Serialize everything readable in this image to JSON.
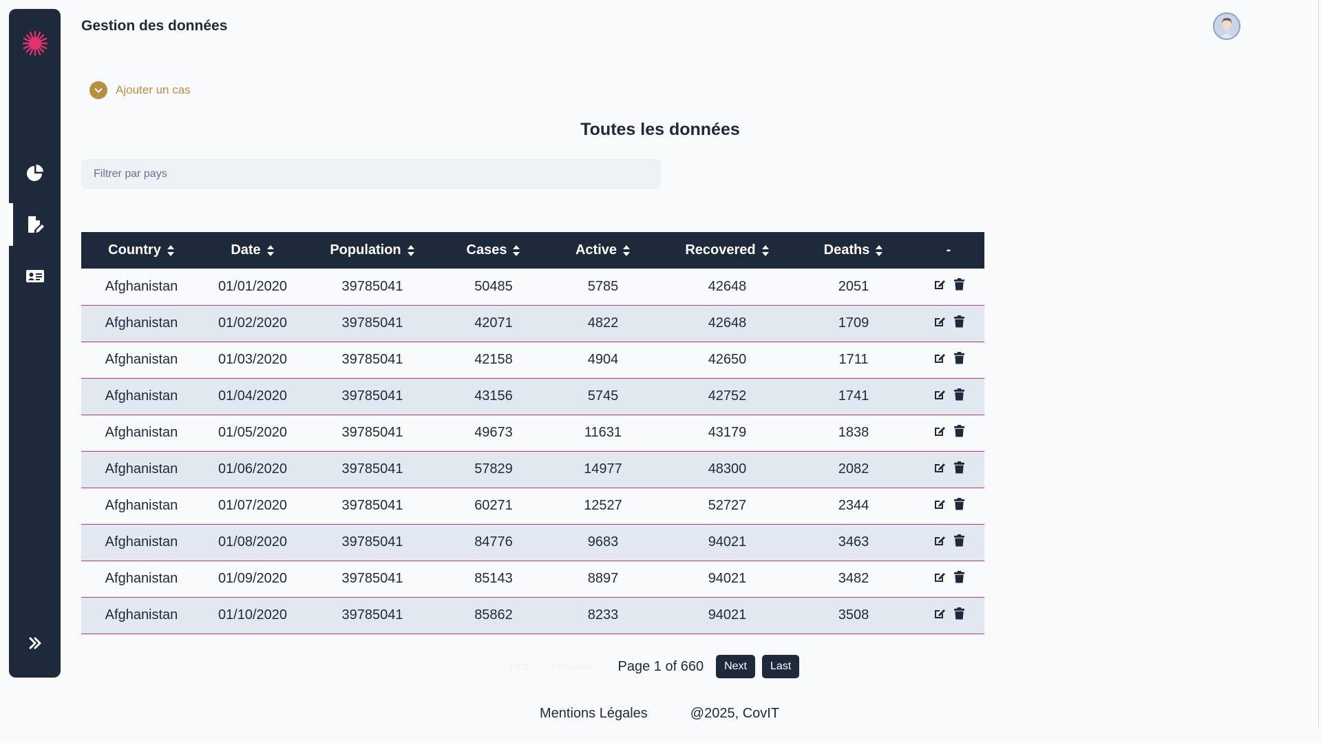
{
  "app": {
    "page_title": "Gestion des données",
    "brand_color": "#e0336b",
    "accent_color": "#b8903d",
    "sidebar_color": "#1e293b"
  },
  "sidebar": {
    "items": [
      {
        "icon": "pie-chart-icon",
        "active": false
      },
      {
        "icon": "file-edit-icon",
        "active": true
      },
      {
        "icon": "id-card-icon",
        "active": false
      }
    ],
    "expand_icon": "double-chevron-right-icon"
  },
  "add_case": {
    "label": "Ajouter un cas"
  },
  "section": {
    "title": "Toutes les données"
  },
  "filter": {
    "placeholder": "Filtrer par pays",
    "value": ""
  },
  "table": {
    "columns": [
      "Country",
      "Date",
      "Population",
      "Cases",
      "Active",
      "Recovered",
      "Deaths",
      "-"
    ],
    "rows": [
      [
        "Afghanistan",
        "01/01/2020",
        "39785041",
        "50485",
        "5785",
        "42648",
        "2051"
      ],
      [
        "Afghanistan",
        "01/02/2020",
        "39785041",
        "42071",
        "4822",
        "42648",
        "1709"
      ],
      [
        "Afghanistan",
        "01/03/2020",
        "39785041",
        "42158",
        "4904",
        "42650",
        "1711"
      ],
      [
        "Afghanistan",
        "01/04/2020",
        "39785041",
        "43156",
        "5745",
        "42752",
        "1741"
      ],
      [
        "Afghanistan",
        "01/05/2020",
        "39785041",
        "49673",
        "11631",
        "43179",
        "1838"
      ],
      [
        "Afghanistan",
        "01/06/2020",
        "39785041",
        "57829",
        "14977",
        "48300",
        "2082"
      ],
      [
        "Afghanistan",
        "01/07/2020",
        "39785041",
        "60271",
        "12527",
        "52727",
        "2344"
      ],
      [
        "Afghanistan",
        "01/08/2020",
        "39785041",
        "84776",
        "9683",
        "94021",
        "3463"
      ],
      [
        "Afghanistan",
        "01/09/2020",
        "39785041",
        "85143",
        "8897",
        "94021",
        "3482"
      ],
      [
        "Afghanistan",
        "01/10/2020",
        "39785041",
        "85862",
        "8233",
        "94021",
        "3508"
      ]
    ]
  },
  "pagination": {
    "first": "First",
    "previous": "Previous",
    "info": "Page 1 of 660",
    "next": "Next",
    "last": "Last"
  },
  "footer": {
    "legal": "Mentions Légales",
    "copyright": "@2025, CovIT"
  }
}
